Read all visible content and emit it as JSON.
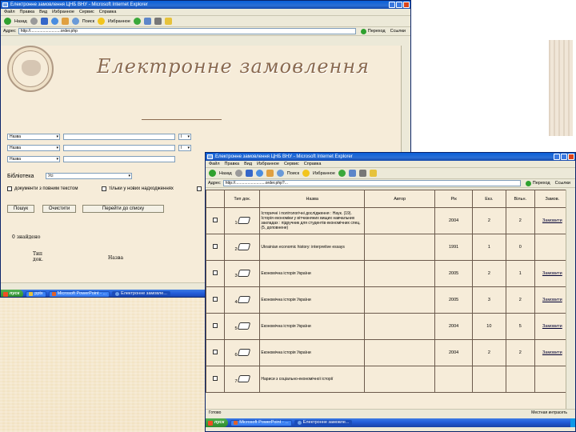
{
  "window1": {
    "title": "Електронне замовлення ЦНБ ВНУ - Microsoft Internet Explorer",
    "menu": [
      "Файл",
      "Правка",
      "Вид",
      "Избранное",
      "Сервис",
      "Справка"
    ],
    "toolbar": {
      "back": "Назад",
      "search": "Поиск",
      "favorites": "Избранное"
    },
    "address_label": "Адрес",
    "address": "http://...........................order.php",
    "go": "Переход",
    "links": "Ссылки",
    "heading": "Електронне замовлення",
    "search_rows": [
      {
        "field": "Назва",
        "op": "І"
      },
      {
        "field": "Назва",
        "op": "І"
      },
      {
        "field": "Назва",
        "op": ""
      }
    ],
    "library_label": "Бібліотека",
    "library_value": "Усі",
    "check_fulltext": "документи з повним текстом",
    "check_new": "тільки у нових надходженнях",
    "search_button": "Пошук",
    "clear_button": "Очистити",
    "goto_button": "Перейти до списку",
    "found": "0 знайдено",
    "col_type": "Тип док.",
    "col_title": "Назва"
  },
  "window2": {
    "title": "Електронне замовлення ЦНБ ВНУ - Microsoft Internet Explorer",
    "menu": [
      "Файл",
      "Правка",
      "Вид",
      "Избранное",
      "Сервис",
      "Справка"
    ],
    "toolbar": {
      "back": "Назад",
      "search": "Поиск",
      "favorites": "Избранное"
    },
    "address_label": "Адрес",
    "address": "http://...........................order.php?...",
    "go": "Переход",
    "links": "Ссылки",
    "status": "Готово",
    "zone": "Местная интрасеть",
    "headers": [
      "",
      "Тип док.",
      "Назва",
      "Автор",
      "Рік",
      "Екз.",
      "Вільн.",
      "Замов."
    ],
    "rows": [
      {
        "n": "1",
        "title": "Історичні і політологічні дослідження : Наук. (19). Історія економіки у вітчизняних вищих навчальних закладах : підручник для студентів економічних спец. (5, доповнене)",
        "author": "",
        "year": "2004",
        "copies": "2",
        "free": "2",
        "order": "Замовити"
      },
      {
        "n": "2",
        "title": "Ukrainian economic history: interpretive essays",
        "author": "",
        "year": "1991",
        "copies": "1",
        "free": "0",
        "order": ""
      },
      {
        "n": "3",
        "title": "Економічна історія України",
        "author": "",
        "year": "2005",
        "copies": "2",
        "free": "1",
        "order": "Замовити"
      },
      {
        "n": "4",
        "title": "Економічна історія України",
        "author": "",
        "year": "2005",
        "copies": "3",
        "free": "2",
        "order": "Замовити"
      },
      {
        "n": "5",
        "title": "Економічна історія України",
        "author": "",
        "year": "2004",
        "copies": "10",
        "free": "5",
        "order": "Замовити"
      },
      {
        "n": "6",
        "title": "Економічна історія України",
        "author": "",
        "year": "2004",
        "copies": "2",
        "free": "2",
        "order": "Замовити"
      },
      {
        "n": "7",
        "title": "Нариси з соціально-економічної історії",
        "author": "",
        "year": "",
        "copies": "",
        "free": "",
        "order": ""
      }
    ]
  },
  "taskbar1": {
    "start": "пуск",
    "tasks": [
      "pptx",
      "Microsoft PowerPoint - ...",
      "Електронне замовле..."
    ]
  },
  "taskbar2": {
    "start": "пуск",
    "tasks": [
      "Microsoft PowerPoint - ...",
      "Електронне замовле..."
    ]
  }
}
